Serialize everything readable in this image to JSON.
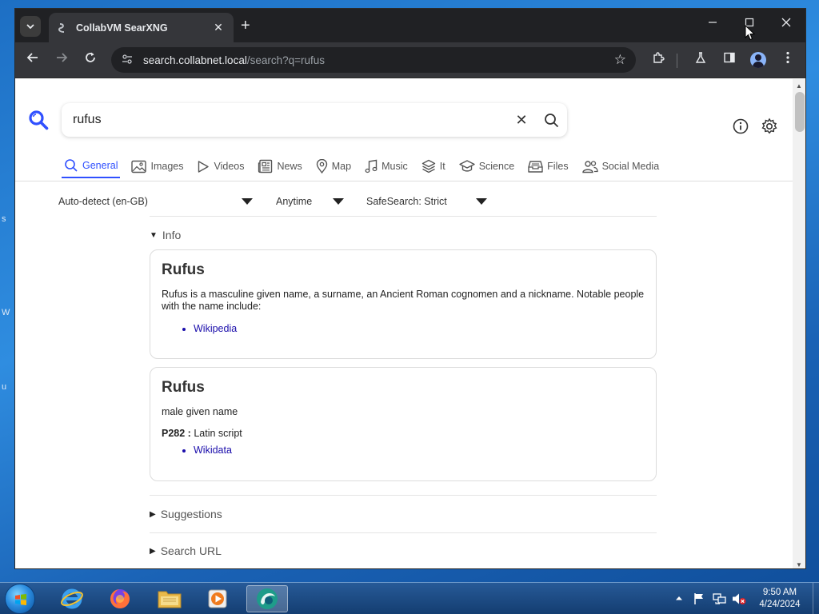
{
  "browser": {
    "tab_title": "CollabVM SearXNG",
    "new_tab": "+",
    "url_host": "search.collabnet.local",
    "url_path": "/search?q=rufus"
  },
  "search": {
    "query": "rufus",
    "categories": [
      {
        "label": "General",
        "active": true,
        "icon": "search-icon"
      },
      {
        "label": "Images",
        "icon": "image-icon"
      },
      {
        "label": "Videos",
        "icon": "play-icon"
      },
      {
        "label": "News",
        "icon": "newspaper-icon"
      },
      {
        "label": "Map",
        "icon": "map-pin-icon"
      },
      {
        "label": "Music",
        "icon": "music-note-icon"
      },
      {
        "label": "It",
        "icon": "layers-icon"
      },
      {
        "label": "Science",
        "icon": "graduation-cap-icon"
      },
      {
        "label": "Files",
        "icon": "file-tray-icon"
      },
      {
        "label": "Social Media",
        "icon": "people-icon"
      }
    ],
    "filters": {
      "language": "Auto-detect (en-GB)",
      "time": "Anytime",
      "safesearch": "SafeSearch: Strict"
    }
  },
  "info_section": {
    "label": "Info",
    "boxes": [
      {
        "title": "Rufus",
        "text": "Rufus is a masculine given name, a surname, an Ancient Roman cognomen and a nickname. Notable people with the name include:",
        "link": "Wikipedia"
      },
      {
        "title": "Rufus",
        "text": "male given name",
        "attr_key": "P282 :",
        "attr_value": " Latin script",
        "link": "Wikidata"
      }
    ]
  },
  "sections": {
    "suggestions": "Suggestions",
    "search_url": "Search URL"
  },
  "taskbar": {
    "time": "9:50 AM",
    "date": "4/24/2024"
  },
  "colors": {
    "accent": "#3050ff",
    "link": "#1a0dab",
    "chrome_dark": "#202124",
    "chrome_toolbar": "#35363a"
  }
}
